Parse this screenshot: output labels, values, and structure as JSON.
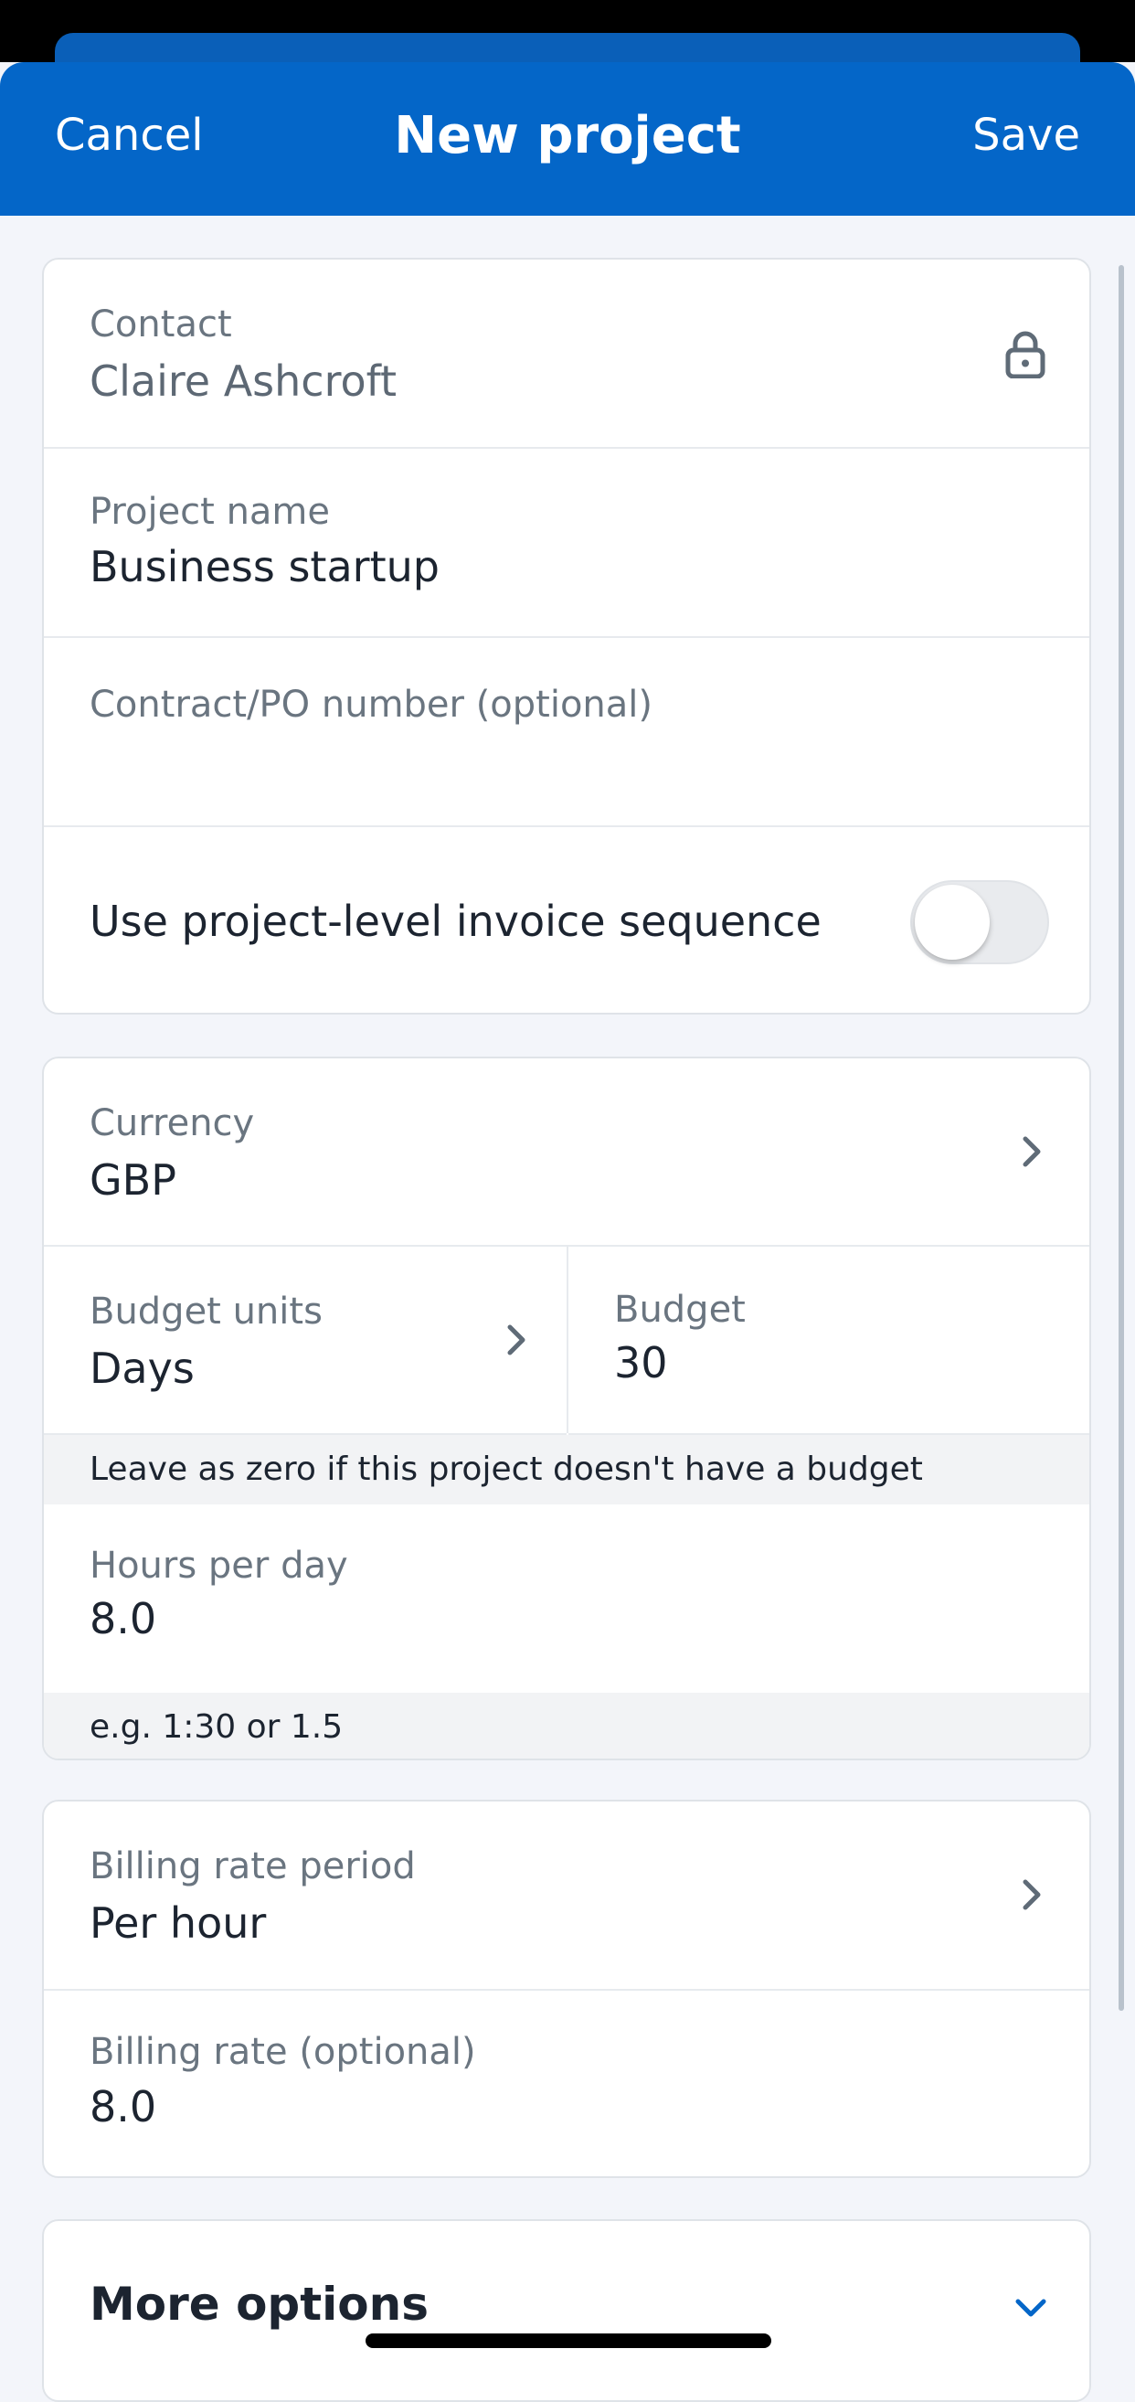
{
  "header": {
    "cancel_label": "Cancel",
    "title": "New project",
    "save_label": "Save"
  },
  "form": {
    "contact": {
      "label": "Contact",
      "value": "Claire Ashcroft",
      "icon": "lock-icon"
    },
    "project_name": {
      "label": "Project name",
      "value": "Business startup"
    },
    "contract_po": {
      "label": "Contract/PO number (optional)",
      "value": ""
    },
    "invoice_sequence": {
      "label": "Use project-level invoice sequence",
      "enabled": false
    },
    "currency": {
      "label": "Currency",
      "value": "GBP"
    },
    "budget_units": {
      "label": "Budget units",
      "value": "Days"
    },
    "budget": {
      "label": "Budget",
      "value": "30"
    },
    "budget_hint": "Leave as zero if this project doesn't have a budget",
    "hours_per_day": {
      "label": "Hours per day",
      "value": "8.0"
    },
    "hours_hint": "e.g. 1:30 or 1.5",
    "billing_rate_period": {
      "label": "Billing rate period",
      "value": "Per hour"
    },
    "billing_rate": {
      "label": "Billing rate (optional)",
      "value": "8.0"
    },
    "more_options": {
      "label": "More options",
      "icon": "chevron-down-icon"
    }
  },
  "colors": {
    "nav_background": "#0466c8",
    "accent": "#0466c8",
    "page_background": "#f3f5fa"
  }
}
